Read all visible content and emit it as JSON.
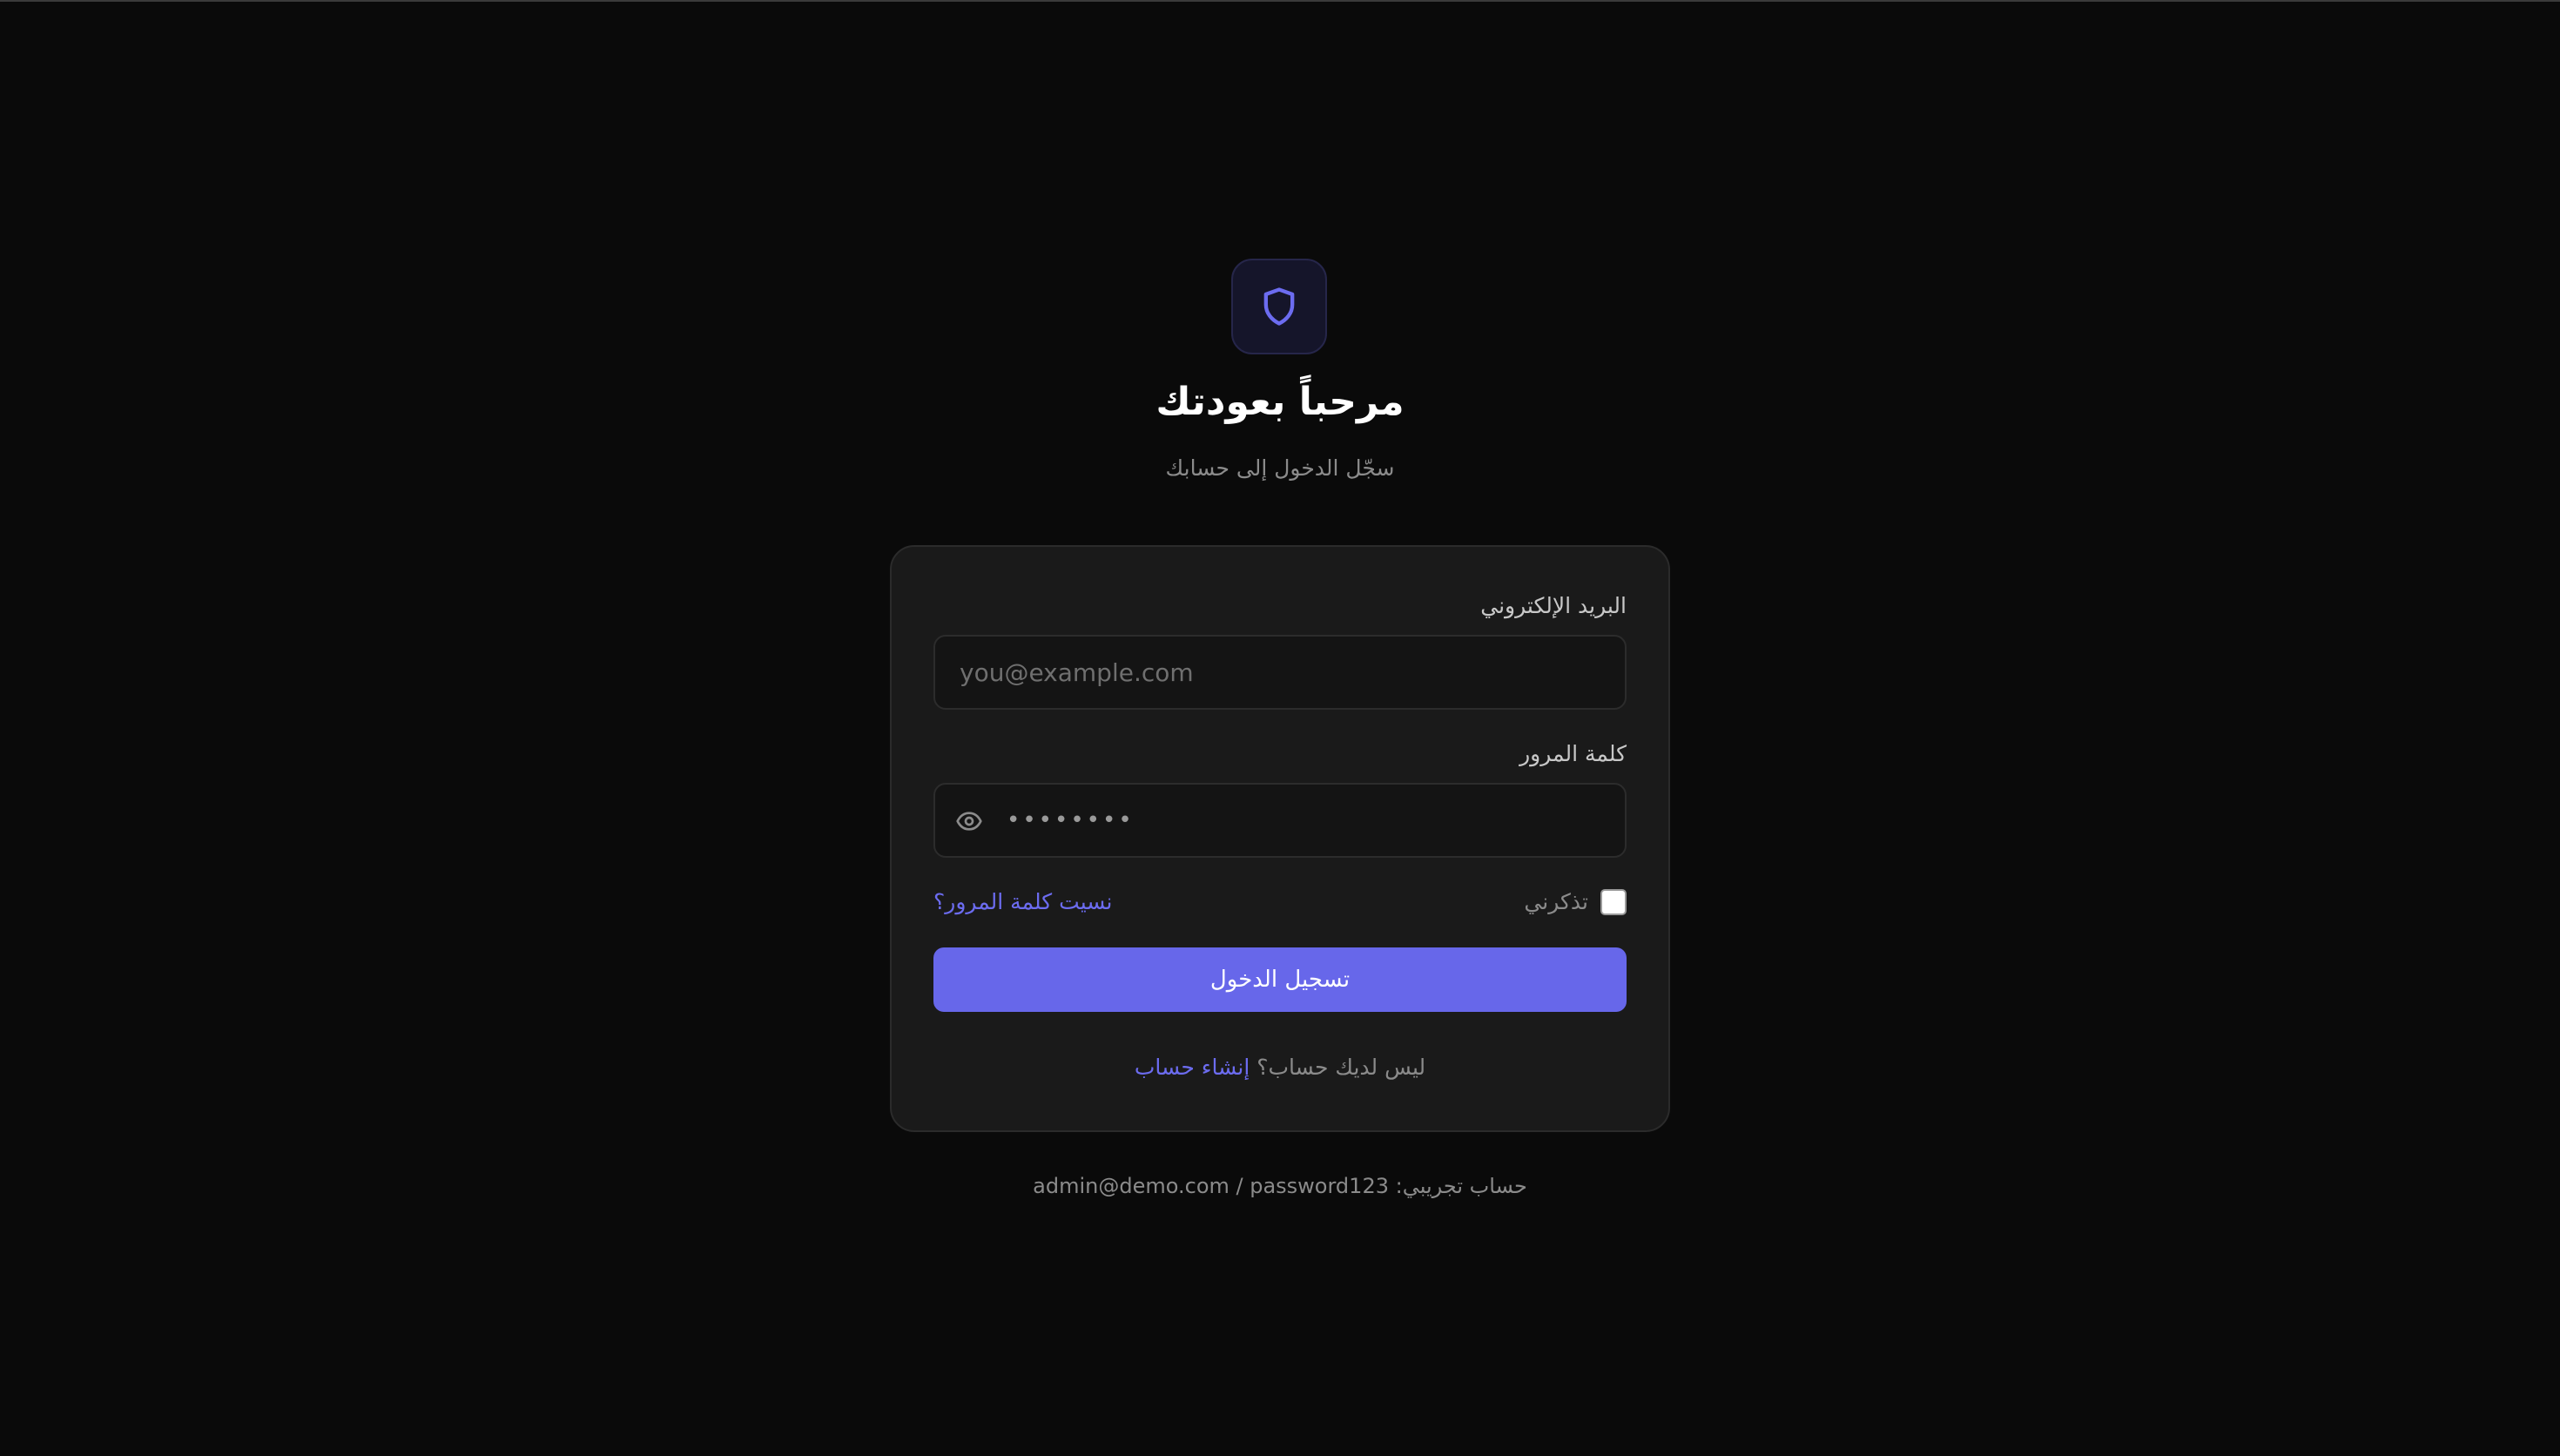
{
  "header": {
    "logo_icon": "shield-icon",
    "title": "مرحباً بعودتك",
    "subtitle": "سجّل الدخول إلى حسابك"
  },
  "form": {
    "email": {
      "label": "البريد الإلكتروني",
      "placeholder": "you@example.com",
      "value": ""
    },
    "password": {
      "label": "كلمة المرور",
      "masked_value": "••••••••",
      "toggle_icon": "eye-icon"
    },
    "remember_me": {
      "label": "تذكرني",
      "checked": false
    },
    "forgot_password_label": "نسيت كلمة المرور؟",
    "submit_label": "تسجيل الدخول",
    "signup_prompt": "ليس لديك حساب؟",
    "signup_link": "إنشاء حساب"
  },
  "demo": {
    "prefix": "حساب تجريبي:",
    "credentials": "admin@demo.com / password123"
  },
  "colors": {
    "background": "#0a0a0a",
    "card": "#1a1a1a",
    "accent": "#6767ea",
    "link": "#6c6cf0",
    "muted_text": "#8b8b8b"
  }
}
